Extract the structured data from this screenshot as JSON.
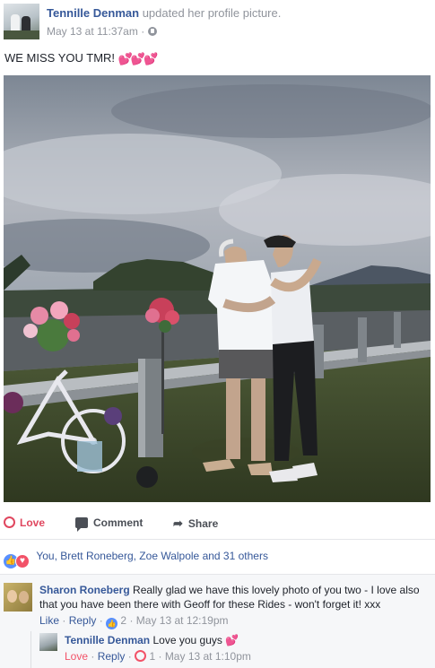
{
  "post": {
    "author": "Tennille Denman",
    "action": "updated her profile picture.",
    "timestamp": "May 13 at 11:37am",
    "separator": "·",
    "privacy_icon": "globe-icon",
    "status_text": "WE MISS YOU TMR!",
    "status_emoji": "💕💕💕"
  },
  "actions": {
    "love": "Love",
    "comment": "Comment",
    "share": "Share"
  },
  "reactions": {
    "icons": [
      "like-icon",
      "love-icon"
    ],
    "summary": "You, Brett Roneberg, Zoe Walpole and 31 others"
  },
  "comments": [
    {
      "author": "Sharon Roneberg",
      "text": "Really glad we have this lovely photo of you two - I love also that you have been there with Geoff for these Rides - won't forget it! xxx",
      "like_label": "Like",
      "reply_label": "Reply",
      "reaction_count": "2",
      "timestamp": "May 13 at 12:19pm",
      "replies": [
        {
          "author": "Tennille Denman",
          "text": "Love you guys",
          "emoji": "💕",
          "like_label": "Love",
          "reply_label": "Reply",
          "reaction_count": "1",
          "timestamp": "May 13 at 1:10pm"
        }
      ]
    }
  ],
  "colors": {
    "link": "#365899",
    "meta": "#90949c",
    "love": "#e0475f",
    "like": "#5890ff"
  }
}
